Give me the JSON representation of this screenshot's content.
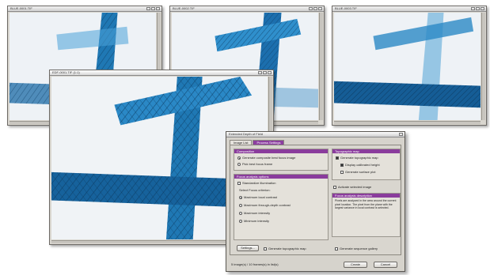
{
  "windows": {
    "top_left": {
      "title": "BLUE-0001.TIF"
    },
    "top_middle": {
      "title": "BLUE-0002.TIF"
    },
    "top_right": {
      "title": "BLUE-0003.TIF"
    },
    "main": {
      "title": "EDF-0001.TIF (1:1)"
    }
  },
  "dialog": {
    "title": "Extended Depth of Field",
    "tabs": [
      {
        "label": "Image List"
      },
      {
        "label": "Process Settings"
      }
    ],
    "composition": {
      "header": "Composition",
      "options": [
        {
          "label": "Generate composite best focus image",
          "checked": true
        },
        {
          "label": "Pick best focus frame",
          "checked": false
        }
      ]
    },
    "focus_analysis": {
      "header": "Focus analysis options",
      "standardize_label": "Standardize illumination",
      "standardize_checked": false,
      "select_label": "Select Focus criterion:",
      "criteria": [
        {
          "label": "Maximum local contrast",
          "checked": true
        },
        {
          "label": "Maximum through-depth contrast",
          "checked": false
        },
        {
          "label": "Maximum intensity",
          "checked": false
        },
        {
          "label": "Minimum intensity",
          "checked": false
        }
      ]
    },
    "topographic": {
      "header": "Topographic map",
      "options": [
        {
          "label": "Generate topographic map",
          "checked": true
        },
        {
          "label": "Display calibrated height",
          "checked": true
        },
        {
          "label": "Generate surface plot",
          "checked": false
        }
      ]
    },
    "activate_label": "Activate selected image",
    "description": {
      "header": "Focus analysis description",
      "text": "Pixels are analyzed in the area around the current pixel location. The pixel from the plane with the largest variance in local contrast is selected."
    },
    "settings_button": "Settings...",
    "gen_topo_label": "Generate topographic map",
    "gen_seq_label": "Generate sequence gallery",
    "status_text": "5 image(s) / 10 frames(s) in list(s)",
    "create_button": "Create",
    "cancel_button": "Cancel"
  },
  "colors": {
    "fiber": "#1f78b4",
    "fiber_dark": "#134f7a",
    "accent": "#8a3c9c",
    "background": "#f1f4f7"
  }
}
